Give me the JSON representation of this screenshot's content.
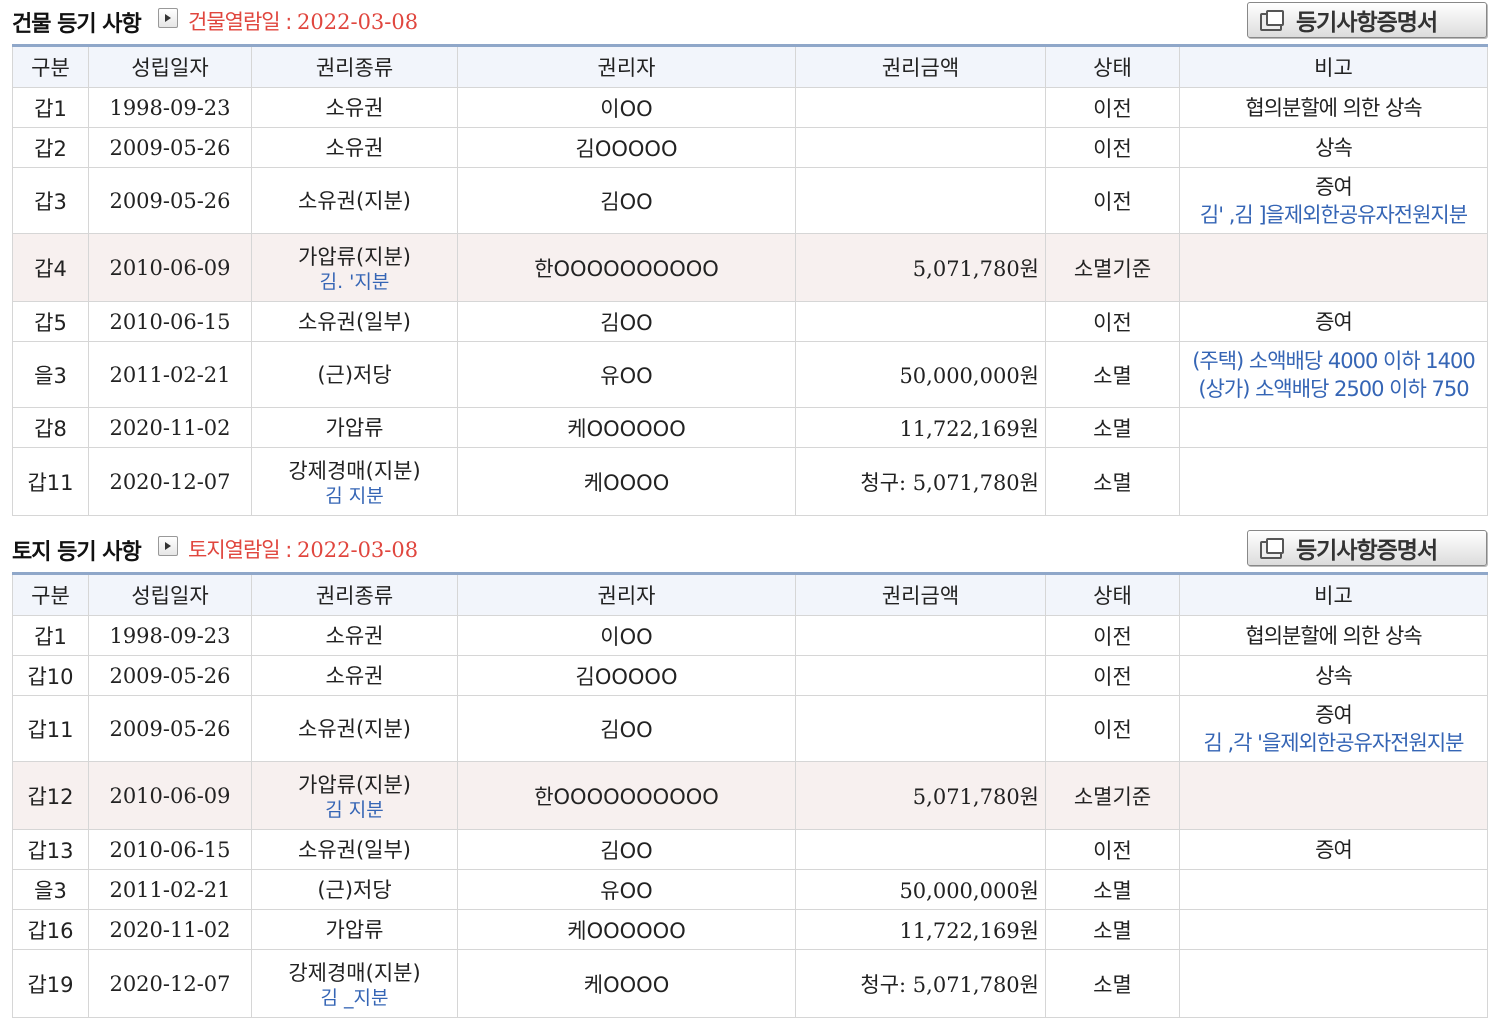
{
  "columns": [
    "구분",
    "성립일자",
    "권리종류",
    "권리자",
    "권리금액",
    "상태",
    "비고"
  ],
  "building": {
    "title": "건물 등기 사항",
    "view_label": "건물열람일 : ",
    "view_date": "2022-03-08",
    "cert_button": "등기사항증명서",
    "rows": [
      {
        "no": "갑1",
        "date": "1998-09-23",
        "kind": "소유권",
        "kind_sub": "",
        "holder": "이OO",
        "amount": "",
        "status": "이전",
        "note": "협의분할에 의한 상속",
        "note_sub": ""
      },
      {
        "no": "갑2",
        "date": "2009-05-26",
        "kind": "소유권",
        "kind_sub": "",
        "holder": "김OOOOO",
        "amount": "",
        "status": "이전",
        "note": "상속",
        "note_sub": ""
      },
      {
        "no": "갑3",
        "date": "2009-05-26",
        "kind": "소유권(지분)",
        "kind_sub": "",
        "holder": "김OO",
        "amount": "",
        "status": "이전",
        "note": "증여",
        "note_sub": "김'     ,김      ]을제외한공유자전원지분"
      },
      {
        "no": "갑4",
        "date": "2010-06-09",
        "kind": "가압류(지분)",
        "kind_sub": "김.      '지분",
        "holder": "한OOOOOOOOOO",
        "amount": "5,071,780원",
        "status": "소멸기준",
        "note": "",
        "note_sub": ""
      },
      {
        "no": "갑5",
        "date": "2010-06-15",
        "kind": "소유권(일부)",
        "kind_sub": "",
        "holder": "김OO",
        "amount": "",
        "status": "이전",
        "note": "증여",
        "note_sub": ""
      },
      {
        "no": "을3",
        "date": "2011-02-21",
        "kind": "(근)저당",
        "kind_sub": "",
        "holder": "유OO",
        "amount": "50,000,000원",
        "status": "소멸",
        "note": "",
        "note_sub": "(주택) 소액배당 4000 이하 1400",
        "note_sub2": "(상가) 소액배당 2500 이하 750"
      },
      {
        "no": "갑8",
        "date": "2020-11-02",
        "kind": "가압류",
        "kind_sub": "",
        "holder": "케OOOOOO",
        "amount": "11,722,169원",
        "status": "소멸",
        "note": "",
        "note_sub": ""
      },
      {
        "no": "갑11",
        "date": "2020-12-07",
        "kind": "강제경매(지분)",
        "kind_sub": "김      지분",
        "holder": "케OOOO",
        "amount": "청구: 5,071,780원",
        "status": "소멸",
        "note": "",
        "note_sub": ""
      }
    ]
  },
  "land": {
    "title": "토지 등기 사항",
    "view_label": "토지열람일 : ",
    "view_date": "2022-03-08",
    "cert_button": "등기사항증명서",
    "rows": [
      {
        "no": "갑1",
        "date": "1998-09-23",
        "kind": "소유권",
        "kind_sub": "",
        "holder": "이OO",
        "amount": "",
        "status": "이전",
        "note": "협의분할에 의한 상속",
        "note_sub": ""
      },
      {
        "no": "갑10",
        "date": "2009-05-26",
        "kind": "소유권",
        "kind_sub": "",
        "holder": "김OOOOO",
        "amount": "",
        "status": "이전",
        "note": "상속",
        "note_sub": ""
      },
      {
        "no": "갑11",
        "date": "2009-05-26",
        "kind": "소유권(지분)",
        "kind_sub": "",
        "holder": "김OO",
        "amount": "",
        "status": "이전",
        "note": "증여",
        "note_sub": "김      ,각      '을제외한공유자전원지분"
      },
      {
        "no": "갑12",
        "date": "2010-06-09",
        "kind": "가압류(지분)",
        "kind_sub": "김      지분",
        "holder": "한OOOOOOOOOO",
        "amount": "5,071,780원",
        "status": "소멸기준",
        "note": "",
        "note_sub": ""
      },
      {
        "no": "갑13",
        "date": "2010-06-15",
        "kind": "소유권(일부)",
        "kind_sub": "",
        "holder": "김OO",
        "amount": "",
        "status": "이전",
        "note": "증여",
        "note_sub": ""
      },
      {
        "no": "을3",
        "date": "2011-02-21",
        "kind": "(근)저당",
        "kind_sub": "",
        "holder": "유OO",
        "amount": "50,000,000원",
        "status": "소멸",
        "note": "",
        "note_sub": ""
      },
      {
        "no": "갑16",
        "date": "2020-11-02",
        "kind": "가압류",
        "kind_sub": "",
        "holder": "케OOOOOO",
        "amount": "11,722,169원",
        "status": "소멸",
        "note": "",
        "note_sub": ""
      },
      {
        "no": "갑19",
        "date": "2020-12-07",
        "kind": "강제경매(지분)",
        "kind_sub": "김     _지분",
        "holder": "케OOOO",
        "amount": "청구: 5,071,780원",
        "status": "소멸",
        "note": "",
        "note_sub": ""
      }
    ]
  }
}
